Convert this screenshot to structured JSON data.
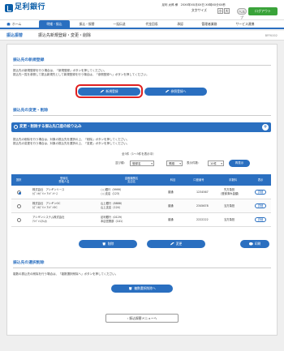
{
  "header": {
    "bank_name": "足利銀行",
    "user_info": "足利 太郎 様　20XX年XX月XX日 XX時XX分XX秒",
    "font_size_label": "文字サイズ",
    "font_small": "小",
    "font_large": "大",
    "help_label": "ヘルプ",
    "logout_label": "ログアウト"
  },
  "nav": {
    "home": "ホーム",
    "items": [
      "明細・振込",
      "振込・振替",
      "一括伝送",
      "代金回収",
      "承認",
      "管理者業務",
      "サービス連携"
    ],
    "active_index": 1
  },
  "page": {
    "title_main": "振込振替",
    "title_sub": "振込先新規登録・変更・削除",
    "screen_id": "BFFK002"
  },
  "register": {
    "title": "振込先の新規登録",
    "desc1": "振込先の新規登録を行う場合は、「新規登録」ボタンを押してください。",
    "desc2": "振込先一覧を参照して振込新規先として新規登録を行う場合は、「参照登録へ」ボタンを押してください。",
    "new_button": "新規登録",
    "ref_button": "参照登録へ"
  },
  "modify": {
    "title": "振込先の変更・削除",
    "filter_label": "変更・削除する振込先口座の絞り込み",
    "desc1": "振込先の削除を行う場合は、対象の振込先を選択の上、「削除」ボタンを押してください。",
    "desc2": "振込先の変更を行う場合は、対象の振込先を選択の上、「変更」ボタンを押してください。",
    "count": "全3件（1〜3件を表示中）",
    "sort_label": "並び順：",
    "sort_value": "登録名",
    "order_value": "昇順",
    "per_page_label": "表示件数：",
    "per_page_value": "10件",
    "redisplay": "再表示",
    "columns": {
      "select": "選択",
      "name": "登録名\n受取人名",
      "bank": "金融機関名\n支店名",
      "type": "科目",
      "account": "口座番号",
      "fee": "手数料",
      "display": "表示"
    },
    "rows": [
      {
        "name": "株式会社　アシギンリース",
        "payee": "ｶﾌﾞｼｷｶﾞｲｼｬ ｱｼｷﾞﾝﾘｰｽ",
        "bank": "○○銀行（9999）",
        "branch": "○○支店（123）",
        "type": "普通",
        "account": "1234567",
        "fee": "先方負担",
        "fee2": "(登録済み金額)",
        "detail": "詳細",
        "selected": true
      },
      {
        "name": "株式会社　アシギンOC",
        "payee": "ｶﾌﾞｼｷｶﾞｲｼｬ ｱｼｷﾞﾝOC",
        "bank": "山上銀行（8888）",
        "branch": "山上支店（124）",
        "type": "普通",
        "account": "2345678",
        "fee": "当方負担",
        "fee2": "",
        "detail": "詳細",
        "selected": false
      },
      {
        "name": "アシギンシステム株式会社",
        "payee": "ｱｼｷﾞﾝｼｽﾃﾑ(ｶ",
        "bank": "足利銀行（0129）",
        "branch": "本店営業部（101）",
        "type": "普通",
        "account": "2222222",
        "fee": "当方負担",
        "fee2": "",
        "detail": "詳細",
        "selected": false
      }
    ],
    "delete_button": "削除",
    "change_button": "変更",
    "print_button": "印刷"
  },
  "bulk": {
    "title": "振込先の選択削除",
    "desc": "複数の振込先の削除を行う場合は、「複数選択削除へ」ボタンを押してください。",
    "button": "複数選択削除へ"
  },
  "footer": {
    "back_button": "振込振替メニューへ"
  }
}
